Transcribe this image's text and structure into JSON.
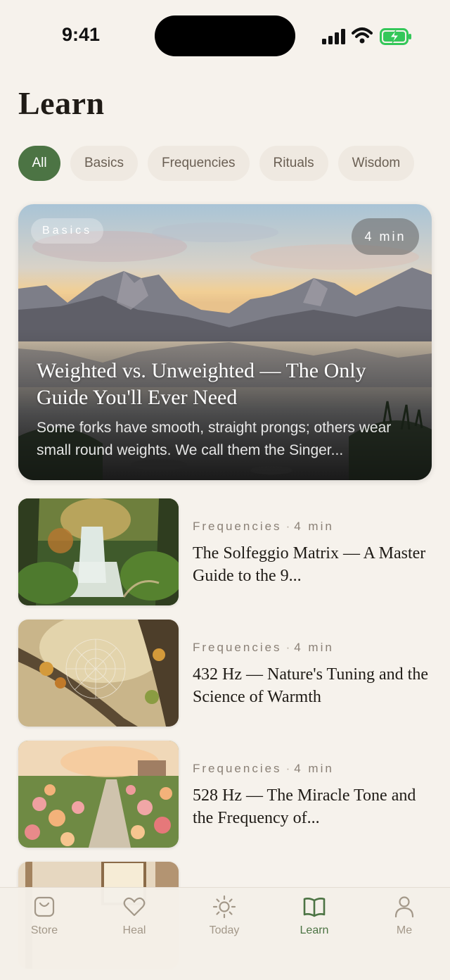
{
  "status_bar": {
    "time": "9:41"
  },
  "page": {
    "title": "Learn"
  },
  "filters": [
    {
      "label": "All",
      "active": true
    },
    {
      "label": "Basics",
      "active": false
    },
    {
      "label": "Frequencies",
      "active": false
    },
    {
      "label": "Rituals",
      "active": false
    },
    {
      "label": "Wisdom",
      "active": false
    }
  ],
  "featured": {
    "tag": "Basics",
    "duration": "4 min",
    "title": "Weighted vs. Unweighted — The Only Guide You'll Ever Need",
    "description": "Some forks have smooth, straight prongs; others wear small round weights. We call them the Singer..."
  },
  "articles": [
    {
      "category": "Frequencies",
      "duration": "4 min",
      "title": "The Solfeggio Matrix — A Master Guide to the 9..."
    },
    {
      "category": "Frequencies",
      "duration": "4 min",
      "title": "432 Hz — Nature's Tuning and the Science of Warmth"
    },
    {
      "category": "Frequencies",
      "duration": "4 min",
      "title": "528 Hz — The Miracle Tone and the Frequency of..."
    }
  ],
  "tabbar": {
    "items": [
      {
        "label": "Store",
        "icon": "bag-icon"
      },
      {
        "label": "Heal",
        "icon": "heart-icon"
      },
      {
        "label": "Today",
        "icon": "sun-icon"
      },
      {
        "label": "Learn",
        "icon": "book-icon"
      },
      {
        "label": "Me",
        "icon": "person-icon"
      }
    ],
    "active": "Learn"
  },
  "colors": {
    "accent": "#4c7444",
    "background": "#f6f2ec",
    "chip": "#efe9e1",
    "battery": "#34c759"
  }
}
